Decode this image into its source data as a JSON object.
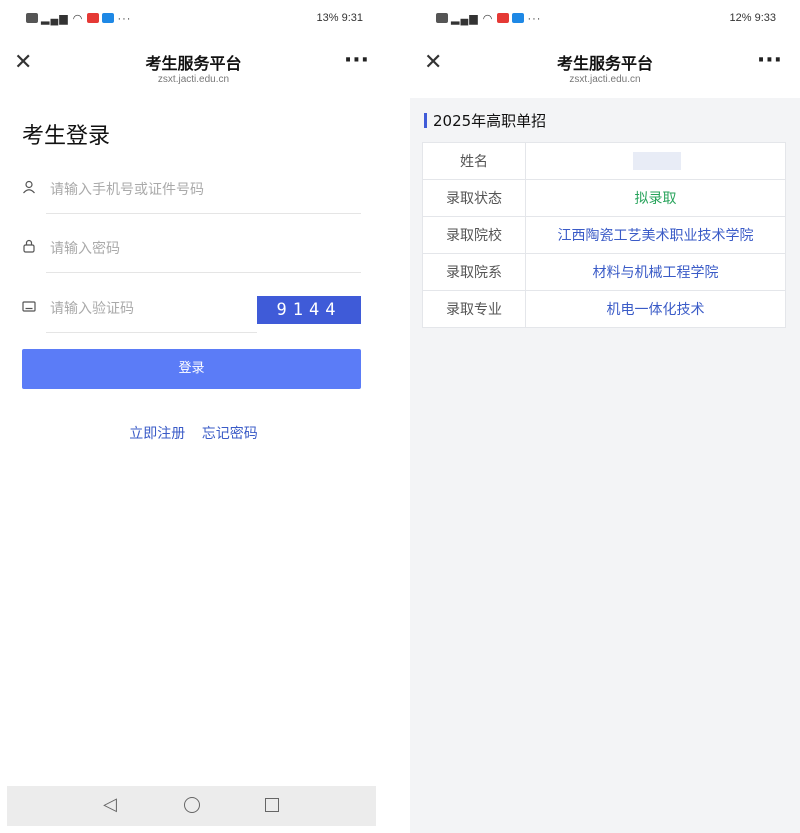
{
  "left": {
    "status": {
      "right": "13% 9:31"
    },
    "titlebar": {
      "title": "考生服务平台",
      "url": "zsxt.jacti.edu.cn"
    },
    "login": {
      "heading": "考生登录",
      "phone_placeholder": "请输入手机号或证件号码",
      "password_placeholder": "请输入密码",
      "code_placeholder": "请输入验证码",
      "captcha": "9144",
      "login_button": "登录",
      "register_link": "立即注册",
      "forgot_link": "忘记密码"
    }
  },
  "right": {
    "status": {
      "right": "12% 9:33"
    },
    "titlebar": {
      "title": "考生服务平台",
      "url": "zsxt.jacti.edu.cn"
    },
    "section_title": "2025年高职单招",
    "rows": [
      {
        "label": "姓名",
        "value": ""
      },
      {
        "label": "录取状态",
        "value": "拟录取"
      },
      {
        "label": "录取院校",
        "value": "江西陶瓷工艺美术职业技术学院"
      },
      {
        "label": "录取院系",
        "value": "材料与机械工程学院"
      },
      {
        "label": "录取专业",
        "value": "机电一体化技术"
      }
    ]
  },
  "colors": {
    "accent": "#5b7cf7",
    "captcha": "#3f5bd8",
    "link": "#3a5bc7",
    "admitted": "#27a35b"
  }
}
